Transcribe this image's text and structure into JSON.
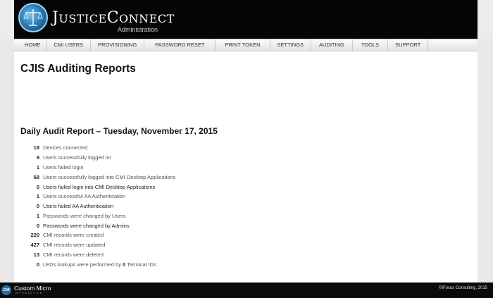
{
  "header": {
    "brand_big_j": "J",
    "brand_rest_1": "USTICE",
    "brand_big_c": "C",
    "brand_rest_2": "ONNECT",
    "subtitle": "Administration",
    "logo_icon": "scales-of-justice-icon"
  },
  "nav": {
    "items": [
      {
        "label": "HOME"
      },
      {
        "label": "CMI USERS"
      },
      {
        "label": "PROVISIONING"
      },
      {
        "label": "PASSWORD RESET"
      },
      {
        "label": "PRINT TOKEN"
      },
      {
        "label": "SETTINGS"
      },
      {
        "label": "AUDITING"
      },
      {
        "label": "TOOLS"
      },
      {
        "label": "SUPPORT"
      }
    ]
  },
  "main": {
    "page_title": "CJIS Auditing Reports",
    "report_title": "Daily Audit Report – Tuesday, November 17, 2015",
    "stats": [
      {
        "value": "18",
        "label": "Devices connected"
      },
      {
        "value": "9",
        "label": "Users successfully logged in!"
      },
      {
        "value": "1",
        "label": "Users failed login"
      },
      {
        "value": "68",
        "label": "Users successfully logged into CMI Desktop Applications"
      },
      {
        "value": "0",
        "label": "Users failed login into CMI Desktop Applications"
      },
      {
        "value": "1",
        "label": "Users successful AA Authentication"
      },
      {
        "value": "0",
        "label": "Users failed AA Authentication"
      },
      {
        "value": "1",
        "label": "Passwords were changed by Users"
      },
      {
        "value": "0",
        "label": "Passwords were changed by Admins"
      },
      {
        "value": "220",
        "label": "CMI records were created"
      },
      {
        "value": "427",
        "label": "CMI records were updated"
      },
      {
        "value": "13",
        "label": "CMI records were deleted"
      }
    ],
    "leds": {
      "value": "0",
      "label_before": "LEDs lookups were performed by ",
      "terminal_count": "0",
      "label_after": " Terminal IDs"
    }
  },
  "footer": {
    "logo_text": "CMI",
    "company": "Custom Micro",
    "tagline": "INTERACTIVE",
    "copyright": "©iFocus Consulting, 2015"
  },
  "colors": {
    "header_bg": "#050505",
    "page_bg": "#e8e8e8",
    "content_bg": "#ffffff",
    "logo_blue": "#2a7fb8"
  }
}
